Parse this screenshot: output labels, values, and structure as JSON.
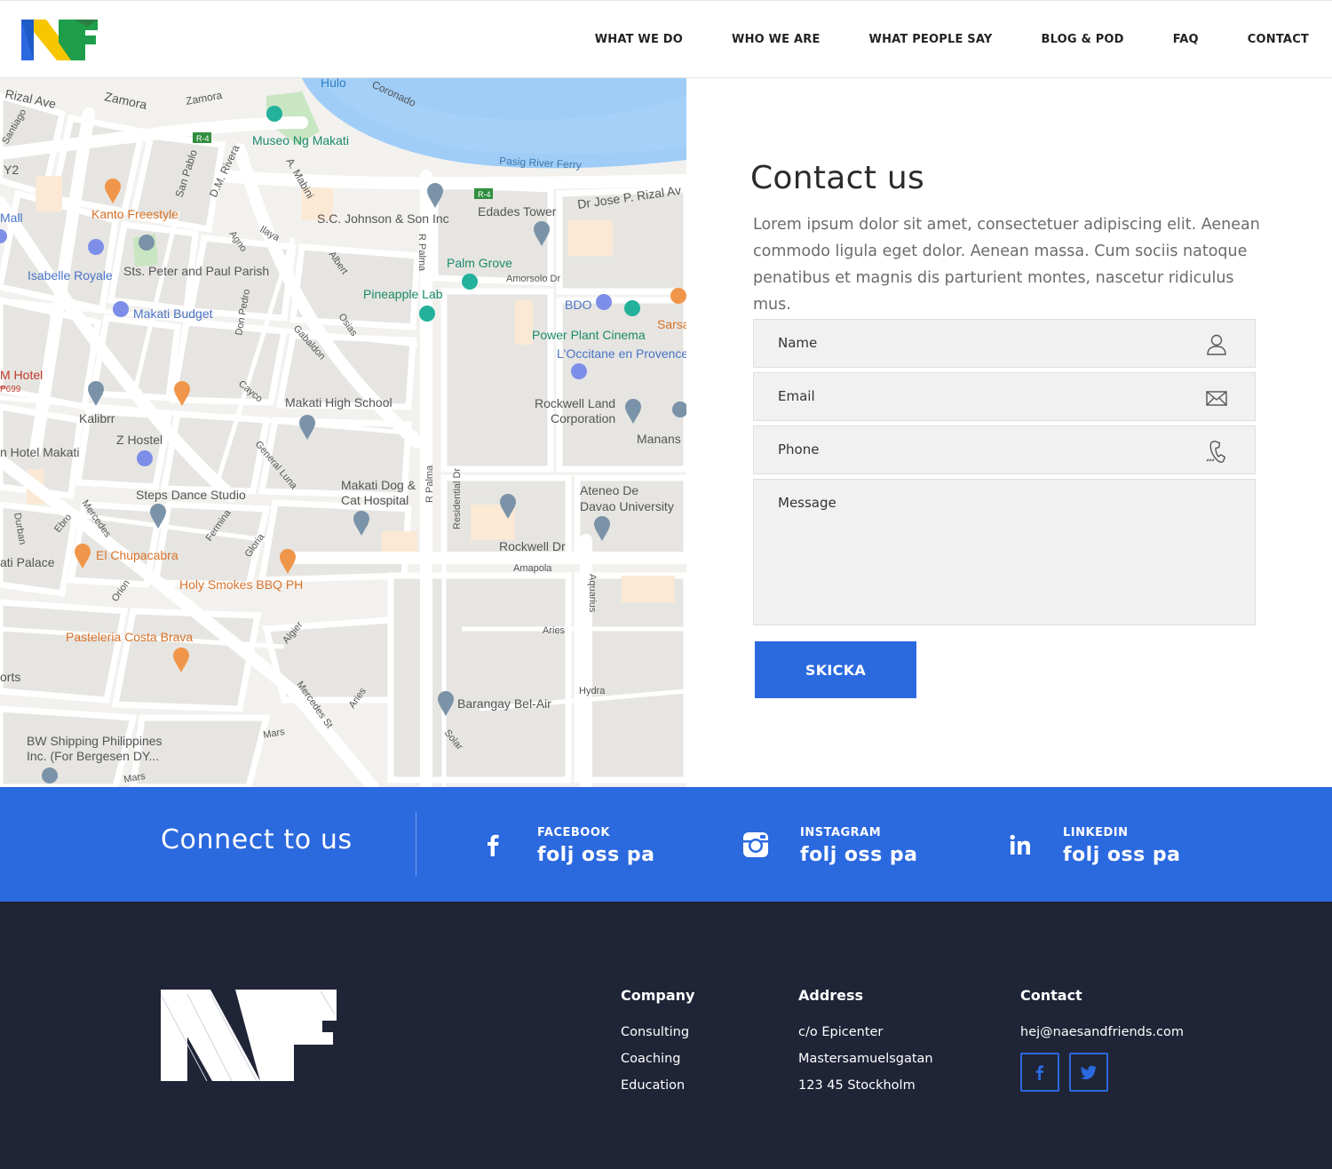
{
  "header": {
    "nav": [
      "WHAT WE DO",
      "WHO WE ARE",
      "WHAT PEOPLE SAY",
      "BLOG & POD",
      "FAQ",
      "CONTACT"
    ]
  },
  "map": {
    "labels": {
      "rizal_ave": "Rizal Ave",
      "zamora1": "Zamora",
      "zamora2": "Zamora",
      "hulo": "Hulo",
      "coronado": "Coronado",
      "museo": "Museo Ng Makati",
      "r4a": "R-4",
      "r4b": "R-4",
      "pasig_ferry": "Pasig River Ferry",
      "santiago": "Santiago",
      "y2": "Y2",
      "mall": "Mall",
      "san_pablo": "San Pablo",
      "dm_rivera": "D.M. Rivera",
      "a_mabini": "A. Mabini",
      "dr_jose": "Dr Jose P. Rizal Av",
      "edades": "Edades Tower",
      "sc_johnson": "S.C. Johnson & Son Inc",
      "kanto": "Kanto Freestyle",
      "agno": "Agno",
      "ilaya": "Ilaya",
      "isabelle": "Isabelle Royale",
      "sts_peter": "Sts. Peter and Paul Parish",
      "albert": "Albert",
      "r_palma": "R Palma",
      "palm_grove": "Palm Grove",
      "amorsolo": "Amorsolo Dr",
      "pineapple": "Pineapple Lab",
      "bdo": "BDO",
      "sarsa": "Sarsa",
      "makati_budget": "Makati Budget",
      "don_pedro": "Don Pedro",
      "osias": "Osias",
      "gabaldon": "Gabaldon",
      "power_plant": "Power Plant Cinema",
      "loccitane": "L'Occitane en Provence",
      "m_hotel": "M Hotel",
      "m_hotel_price": "₱699",
      "cayco": "Cayco",
      "makati_high": "Makati High School",
      "rockwell_land": "Rockwell Land",
      "corporation": "Corporation",
      "kalibrr": "Kalibrr",
      "z_hostel": "Z Hostel",
      "manans": "Manans",
      "n_hotel": "n Hotel Makati",
      "general_luna": "General Luna",
      "makati_dog": "Makati Dog &",
      "cat_hospital": "Cat Hospital",
      "residential": "Residential Dr",
      "r_palma2": "R Palma",
      "ateneo1": "Ateneo De",
      "ateneo2": "Davao University",
      "steps": "Steps Dance Studio",
      "mercedes": "Mercedes",
      "ebro": "Ebro",
      "durban": "Durban",
      "fermina": "Fermina",
      "gloria": "Gloria",
      "rockwell_dr": "Rockwell Dr",
      "amapola": "Amapola",
      "ati_palace": "ati Palace",
      "el_chupa": "El Chupacabra",
      "holy_smokes": "Holy Smokes BBQ PH",
      "orion": "Orion",
      "aquarius": "Aquarius",
      "pasteleria": "Pasteleria Costa Brava",
      "algier": "Algier",
      "aries1": "Aries",
      "orts": "orts",
      "hydra": "Hydra",
      "barangay": "Barangay Bel-Air",
      "mercedes_st": "Mercedes St",
      "aries2": "Aries",
      "bw1": "BW Shipping Philippines",
      "bw2": "Inc. (For Bergesen DY...",
      "mars1": "Mars",
      "solar": "Solar",
      "mars2": "Mars"
    }
  },
  "contact": {
    "title": "Contact us",
    "intro": "Lorem ipsum dolor sit amet, consectetuer adipiscing elit. Aenean commodo ligula eget dolor. Aenean massa. Cum sociis natoque penatibus et magnis dis parturient montes, nascetur ridiculus mus.",
    "fields": {
      "name": "Name",
      "email": "Email",
      "phone": "Phone",
      "message": "Message"
    },
    "submit": "SKICKA"
  },
  "connect": {
    "title": "Connect to us",
    "socials": [
      {
        "network": "FACEBOOK",
        "cta": "folj oss pa",
        "icon": "facebook-icon"
      },
      {
        "network": "INSTAGRAM",
        "cta": "folj oss pa",
        "icon": "instagram-icon"
      },
      {
        "network": "LINKEDIN",
        "cta": "folj oss pa",
        "icon": "linkedin-icon"
      }
    ]
  },
  "footer": {
    "company": {
      "title": "Company",
      "items": [
        "Consulting",
        "Coaching",
        "Education"
      ]
    },
    "address": {
      "title": "Address",
      "lines": [
        "c/o Epicenter",
        "Mastersamuelsgatan",
        "123 45 Stockholm"
      ]
    },
    "contact": {
      "title": "Contact",
      "email": "hej@naesandfriends.com"
    }
  },
  "colors": {
    "brand_blue": "#2b69df",
    "footer_bg": "#1f2436",
    "logo_yellow": "#f7c600",
    "logo_green": "#1e9e4a"
  }
}
